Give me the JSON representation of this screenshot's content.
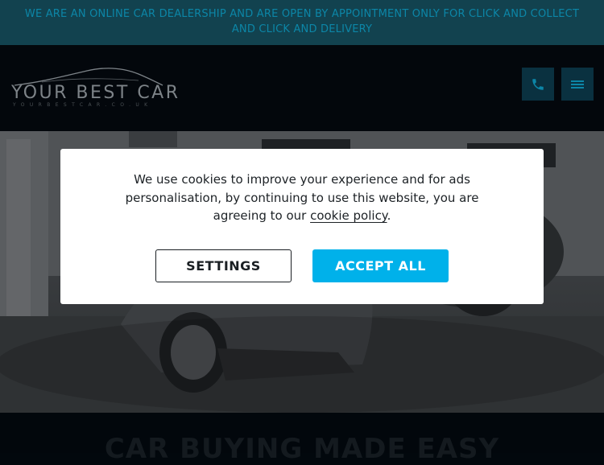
{
  "announcement": {
    "line1": "WE ARE AN ONLINE CAR DEALERSHIP AND ARE OPEN BY APPOINTMENT ONLY FOR CLICK AND COLLECT",
    "line2": "AND CLICK AND DELIVERY"
  },
  "header": {
    "logo_text": "YOUR BEST CAR",
    "logo_subtext": "YOURBESTCAR.CO.UK",
    "phone_icon": "phone-icon",
    "menu_icon": "hamburger-menu-icon"
  },
  "hero": {
    "heading": "CAR BUYING MADE EASY"
  },
  "cookie_dialog": {
    "text_before_link": "We use cookies to improve your experience and for ads personalisation, by continuing to use this website, you are agreeing to our ",
    "link_text": "cookie policy",
    "text_after_link": ".",
    "settings_label": "SETTINGS",
    "accept_label": "ACCEPT ALL"
  },
  "colors": {
    "accent": "#00b1ea",
    "announcement_bg": "#12424f",
    "header_bg": "#03070c",
    "header_button_bg": "#0a3140"
  }
}
